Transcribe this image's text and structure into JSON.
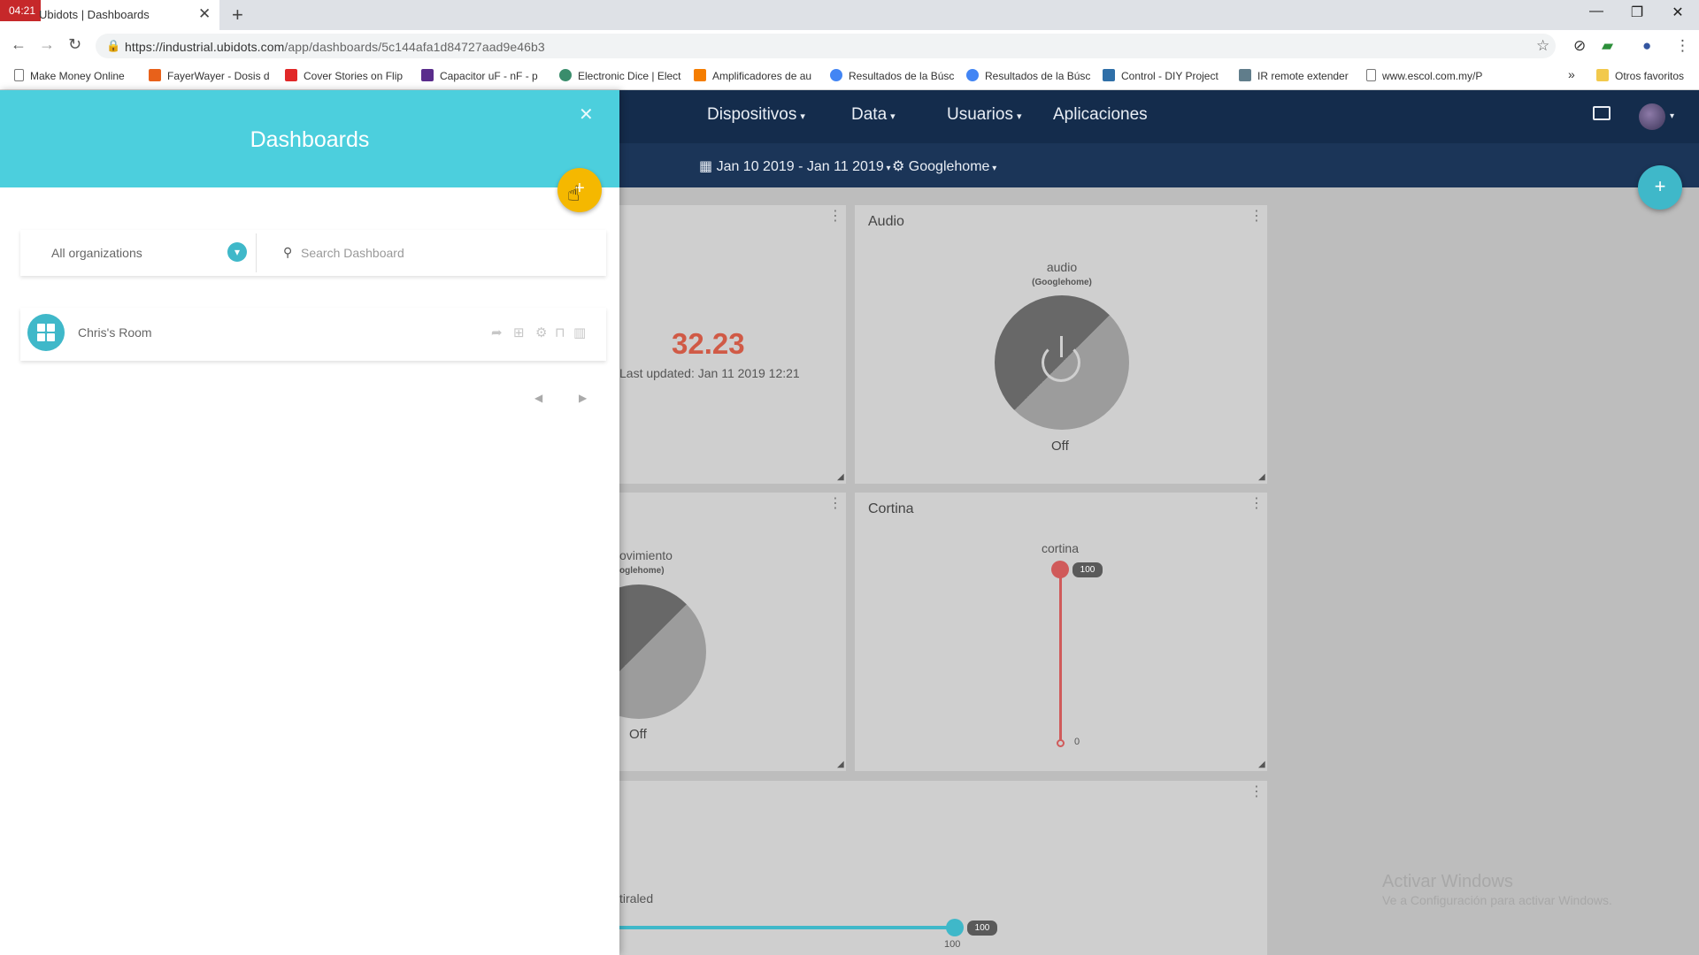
{
  "browser": {
    "tab_badge": "04:21",
    "tab_title": "Ubidots | Dashboards",
    "url_host": "https://industrial.ubidots.com",
    "url_path": "/app/dashboards/5c144afa1d84727aad9e46b3",
    "bookmarks": [
      {
        "label": "Make Money Online",
        "color": "#777777"
      },
      {
        "label": "FayerWayer - Dosis d",
        "color": "#e8611a"
      },
      {
        "label": "Cover Stories on Flip",
        "color": "#e12828"
      },
      {
        "label": "Capacitor uF - nF - p",
        "color": "#5a2d8c"
      },
      {
        "label": "Electronic Dice | Elect",
        "color": "#3a8d6c"
      },
      {
        "label": "Amplificadores de au",
        "color": "#f57d00"
      },
      {
        "label": "Resultados de la Búsc",
        "color": "#4285f4"
      },
      {
        "label": "Resultados de la Búsc",
        "color": "#4285f4"
      },
      {
        "label": "Control - DIY Project",
        "color": "#2f6fa8"
      },
      {
        "label": "IR remote extender",
        "color": "#607d8b"
      },
      {
        "label": "www.escol.com.my/P",
        "color": "#777777"
      }
    ],
    "bookmarks_more": "»",
    "other_bookmarks": "Otros favoritos"
  },
  "navbar": {
    "devices": "Dispositivos",
    "data": "Data",
    "users": "Usuarios",
    "apps": "Aplicaciones",
    "date_range": "Jan 10 2019 - Jan 11 2019",
    "device": "Googlehome"
  },
  "widgets": {
    "metric": {
      "value": "32.23",
      "last_updated": "Last updated: Jan 11 2019 12:21"
    },
    "audio": {
      "title": "Audio",
      "variable": "audio",
      "device": "(Googlehome)",
      "state": "Off"
    },
    "movimiento": {
      "variable": "ovimiento",
      "device": "oglehome)",
      "state": "Off"
    },
    "cortina": {
      "title": "Cortina",
      "variable": "cortina",
      "max": "100",
      "min": "0",
      "value": "100"
    },
    "led": {
      "variable": "tiraled",
      "value": "100",
      "readout": "100"
    }
  },
  "windows_watermark": {
    "line1": "Activar Windows",
    "line2": "Ve a Configuración para activar Windows."
  },
  "panel": {
    "title": "Dashboards",
    "org_filter": "All organizations",
    "search_placeholder": "Search Dashboard",
    "dashboards": [
      {
        "name": "Chris's Room"
      }
    ]
  },
  "colors": {
    "accent": "#4ccfdd",
    "navbar": "#142c4c",
    "add_button": "#f5b800",
    "metric_value": "#d05a46"
  }
}
